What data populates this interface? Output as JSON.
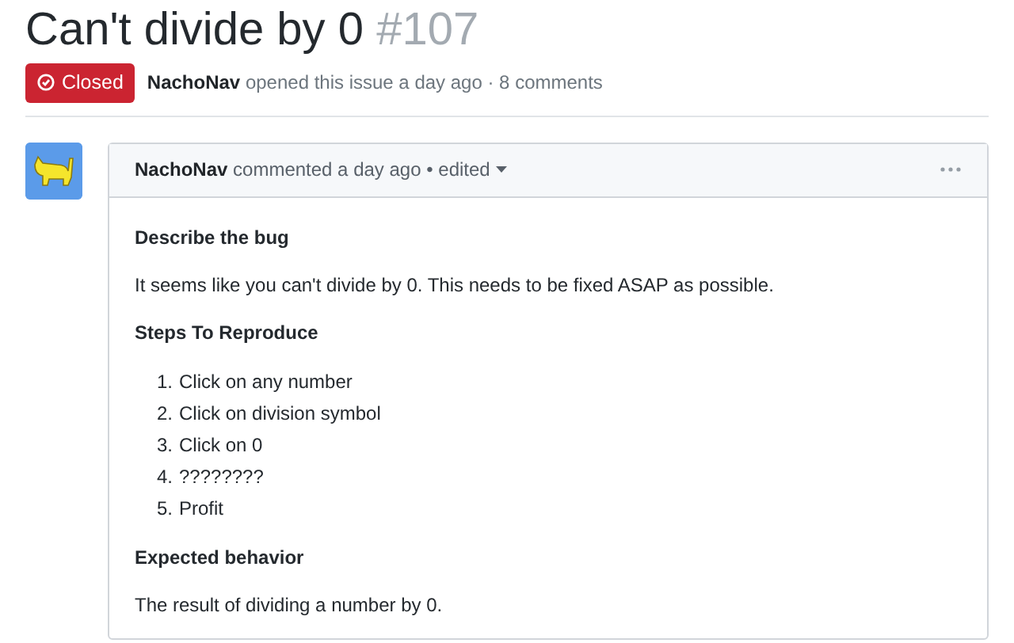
{
  "issue": {
    "title": "Can't divide by 0",
    "number": "#107",
    "closed": true,
    "state_label": "Closed",
    "author": "NachoNav",
    "meta": "opened this issue a day ago · 8 comments"
  },
  "comment": {
    "author": "NachoNav",
    "meta": "commented a day ago •",
    "edited": "edited",
    "body": [
      {
        "kind": "heading",
        "text": "Describe the bug"
      },
      {
        "kind": "paragraph",
        "text": "It seems like you can't divide by 0. This needs to be fixed ASAP as possible."
      },
      {
        "kind": "heading",
        "text": "Steps To Reproduce"
      },
      {
        "kind": "list",
        "items": [
          {
            "number": "1.",
            "text": "Click on any number"
          },
          {
            "number": "2.",
            "text": "Click on division symbol"
          },
          {
            "number": "3.",
            "text": "Click on 0"
          },
          {
            "number": "4.",
            "text": "????????"
          },
          {
            "number": "5.",
            "text": "Profit"
          }
        ]
      },
      {
        "kind": "heading",
        "text": "Expected behavior"
      },
      {
        "kind": "paragraph",
        "text": "The result of dividing a number by 0."
      }
    ]
  }
}
